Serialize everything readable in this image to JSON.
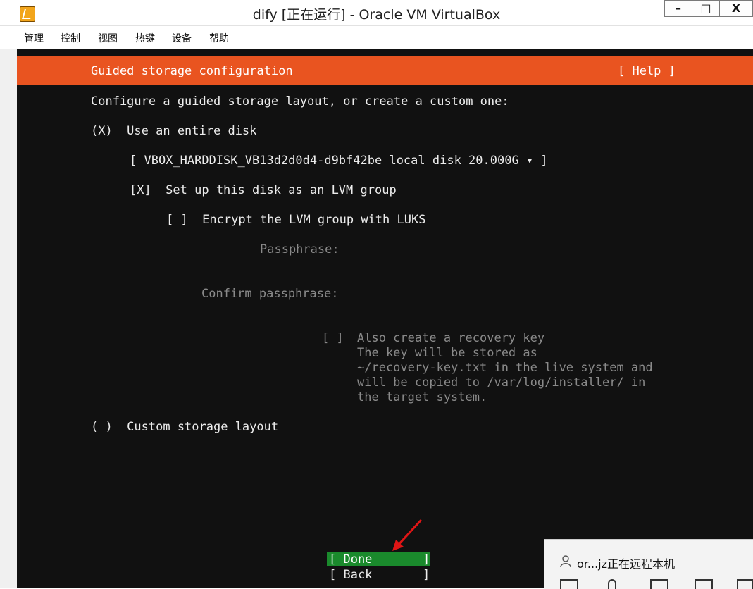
{
  "window": {
    "title": "dify [正在运行] - Oracle VM VirtualBox",
    "controls": {
      "minimize": "–",
      "restore": "□",
      "close": "X"
    }
  },
  "menubar": {
    "items": [
      "管理",
      "控制",
      "视图",
      "热键",
      "设备",
      "帮助"
    ]
  },
  "installer": {
    "header_title": "Guided storage configuration",
    "help_label": "[ Help ]",
    "intro": "Configure a guided storage layout, or create a custom one:",
    "option_entire_disk": "(X)  Use an entire disk",
    "disk_selector": "[ VBOX_HARDDISK_VB13d2d0d4-d9bf42be local disk 20.000G ▾ ]",
    "lvm_checkbox": "[X]  Set up this disk as an LVM group",
    "encrypt_checkbox": "[ ]  Encrypt the LVM group with LUKS",
    "passphrase_label": "Passphrase:",
    "confirm_passphrase_label": "Confirm passphrase:",
    "recovery_checkbox": "[ ]",
    "recovery_lines": [
      "Also create a recovery key",
      "The key will be stored as",
      "~/recovery-key.txt in the live system and",
      "will be copied to /var/log/installer/ in",
      "the target system."
    ],
    "option_custom": "( )  Custom storage layout",
    "done_button": "[ Done       ]",
    "back_button": "[ Back       ]"
  },
  "remote_notice": {
    "text": "or...jz正在远程本机"
  },
  "colors": {
    "header_orange": "#e95420",
    "done_green": "#1a8a2c",
    "terminal_bg": "#111111"
  }
}
